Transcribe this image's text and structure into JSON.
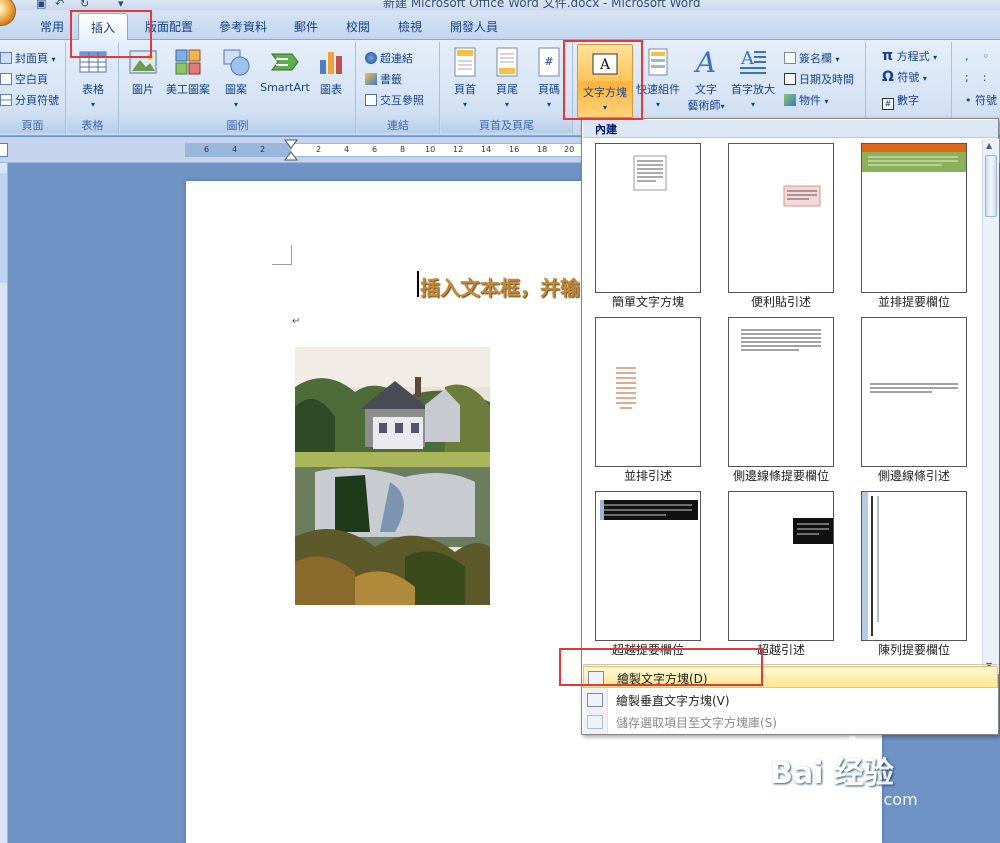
{
  "window": {
    "title": "新建 Microsoft Office Word 文件.docx - Microsoft Word"
  },
  "tabs": [
    {
      "label": "常用"
    },
    {
      "label": "插入"
    },
    {
      "label": "版面配置"
    },
    {
      "label": "參考資料"
    },
    {
      "label": "郵件"
    },
    {
      "label": "校閱"
    },
    {
      "label": "檢視"
    },
    {
      "label": "開發人員"
    }
  ],
  "active_tab": "插入",
  "ribbon": {
    "pages": {
      "label": "頁面",
      "cover": "封面頁",
      "blank": "空白頁",
      "break": "分頁符號"
    },
    "tables": {
      "label": "表格",
      "table": "表格"
    },
    "illustrations": {
      "label": "圖例",
      "picture": "圖片",
      "clipart": "美工圖案",
      "shapes": "圖案",
      "smartart": "SmartArt",
      "chart": "圖表"
    },
    "links": {
      "label": "連結",
      "hyperlink": "超連結",
      "bookmark": "書籤",
      "crossref": "交互參照"
    },
    "header_footer": {
      "label": "頁首及頁尾",
      "header": "頁首",
      "footer": "頁尾",
      "page_number": "頁碼"
    },
    "text": {
      "textbox": "文字方塊",
      "quickparts": "快速組件",
      "wordart_1": "文字",
      "wordart_2": "藝術師",
      "dropcap": "首字放大",
      "signature": "簽名欄",
      "datetime": "日期及時間",
      "object": "物件"
    },
    "symbols": {
      "equation": "方程式",
      "symbol": "符號",
      "number": "數字",
      "special": "符號"
    }
  },
  "ruler": {
    "numbers": [
      "6",
      "4",
      "2",
      "2",
      "4",
      "6",
      "8",
      "10",
      "12",
      "14",
      "16",
      "18",
      "20"
    ]
  },
  "document": {
    "heading": "插入文本框，并输",
    "para_mark": "↵"
  },
  "dropdown": {
    "header": "內建",
    "gallery": [
      {
        "label": "簡單文字方塊"
      },
      {
        "label": "便利貼引述"
      },
      {
        "label": "並排提要欄位"
      },
      {
        "label": "並排引述"
      },
      {
        "label": "側邊線條提要欄位"
      },
      {
        "label": "側邊線條引述"
      },
      {
        "label": "超越提要欄位"
      },
      {
        "label": "超越引述"
      },
      {
        "label": "陳列提要欄位"
      }
    ],
    "menu": [
      {
        "label": "繪製文字方塊(D)"
      },
      {
        "label": "繪製垂直文字方塊(V)"
      },
      {
        "label": "儲存選取項目至文字方塊庫(S)"
      }
    ]
  },
  "watermark": {
    "brand": "Bai 经验",
    "site": "jingyan.baidu.com"
  },
  "colors": {
    "accent_red": "#e23a3a",
    "ribbon_text": "#15428b",
    "heading_text": "#bf8a3e",
    "hover_yellow": "#ffe68d"
  }
}
